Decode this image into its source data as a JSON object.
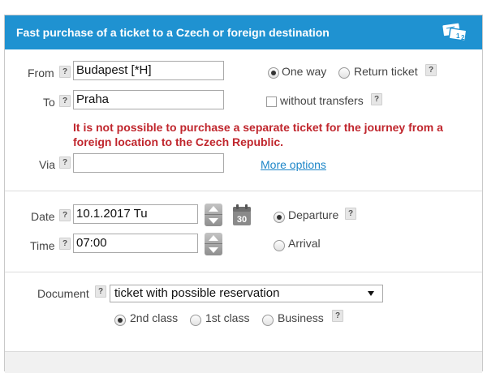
{
  "header": {
    "title": "Fast purchase of a ticket to a Czech or foreign destination",
    "icon": "ticket-icon"
  },
  "route": {
    "from_label": "From",
    "from_value": "Budapest [*H]",
    "to_label": "To",
    "to_value": "Praha",
    "via_label": "Via",
    "via_value": "",
    "help_mark": "?",
    "one_way_label": "One way",
    "return_label": "Return ticket",
    "trip_type_selected": "One way",
    "without_transfers_label": "without transfers",
    "without_transfers_checked": false,
    "error_message": "It is not possible to purchase a separate ticket for the journey from a foreign location to the Czech Republic.",
    "more_options_label": "More options"
  },
  "datetime": {
    "date_label": "Date",
    "date_value": "10.1.2017 Tu",
    "time_label": "Time",
    "time_value": "07:00",
    "calendar_day": "30",
    "departure_label": "Departure",
    "arrival_label": "Arrival",
    "mode_selected": "Departure"
  },
  "document": {
    "label": "Document",
    "selected": "ticket with possible reservation",
    "class_2_label": "2nd class",
    "class_1_label": "1st class",
    "business_label": "Business",
    "class_selected": "2nd class"
  },
  "colors": {
    "header_bg": "#1f92d1",
    "error": "#c0262d",
    "link": "#1d86c8"
  }
}
